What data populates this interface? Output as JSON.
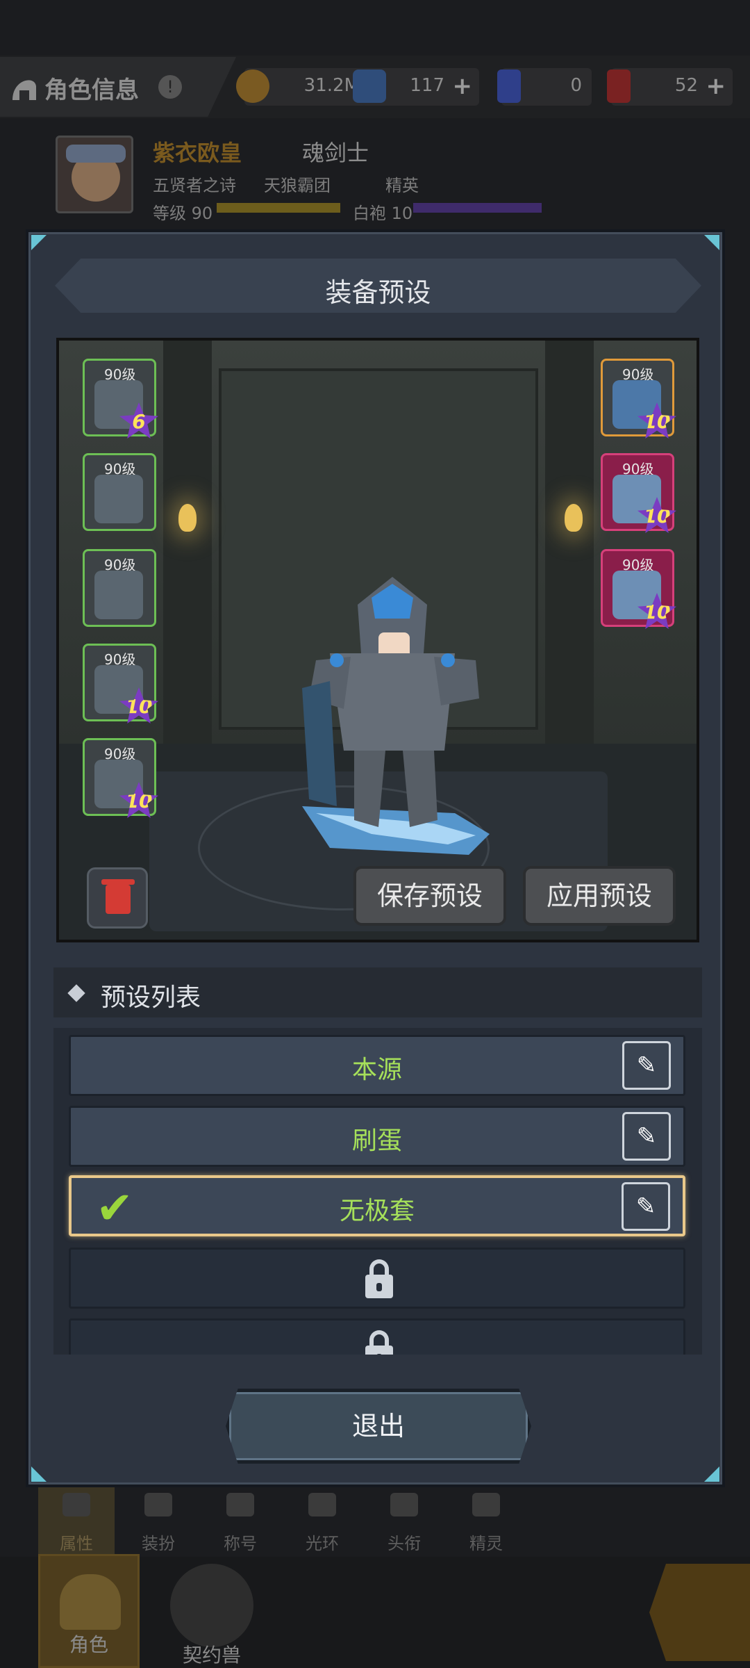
{
  "topbar": {
    "title": "角色信息",
    "resources": [
      {
        "icon": "gold-coin-icon",
        "value": "31.2M"
      },
      {
        "icon": "crystal-icon",
        "value": "117"
      },
      {
        "icon": "card-ticket-icon",
        "value": "0"
      },
      {
        "icon": "red-ticket-icon",
        "value": "52"
      }
    ],
    "plus": "+"
  },
  "profile": {
    "name": "紫衣欧皇",
    "class": "魂剑士",
    "server": "五贤者之诗",
    "guild": "天狼霸团",
    "rank": "精英",
    "level_label": "等级 90",
    "robe_label": "白袍 10",
    "level_progress": 1.0,
    "robe_progress": 1.0
  },
  "dialog": {
    "title": "装备预设",
    "left_slots": [
      {
        "level": "90级",
        "star": "6"
      },
      {
        "level": "90级",
        "star": ""
      },
      {
        "level": "90级",
        "star": ""
      },
      {
        "level": "90级",
        "star": "10"
      },
      {
        "level": "90级",
        "star": "10"
      }
    ],
    "right_slots": [
      {
        "level": "90级",
        "star": "10"
      },
      {
        "level": "90级",
        "star": "10"
      },
      {
        "level": "90级",
        "star": "10"
      }
    ],
    "save_button": "保存预设",
    "apply_button": "应用预设",
    "list_title": "预设列表",
    "presets": [
      {
        "name": "本源",
        "selected": false
      },
      {
        "name": "刷蛋",
        "selected": false
      },
      {
        "name": "无极套",
        "selected": true
      }
    ],
    "check_mark": "✔",
    "edit_icon": "✎",
    "exit_button": "退出"
  },
  "bottom_tabs": [
    "属性",
    "装扮",
    "称号",
    "光环",
    "头衔",
    "精灵"
  ],
  "nav": {
    "role": "角色",
    "pet": "契约兽"
  },
  "colors": {
    "accent_green": "#a6e05a",
    "selection_border": "#e9c88a",
    "star_purple": "#7b3cc2",
    "star_text": "#ffe35a"
  }
}
